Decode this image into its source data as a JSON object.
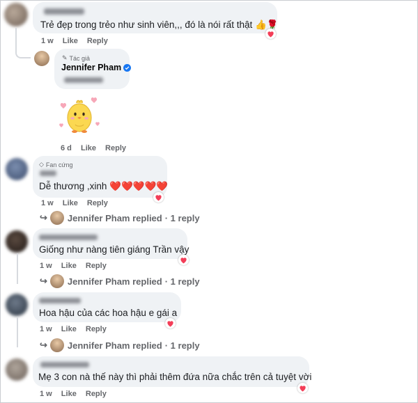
{
  "thread": [
    {
      "text": "Trẻ đẹp trong trẻo như sinh viên,,, đó là nói rất thật 👍🌹",
      "time": "1 w",
      "like": "Like",
      "reply": "Reply"
    }
  ],
  "author_reply": {
    "badge": "Tác giả",
    "name": "Jennifer Pham",
    "time": "6 d",
    "like": "Like",
    "reply": "Reply"
  },
  "comment2": {
    "badge": "Fan cứng",
    "text": "Dễ thương ,xinh ❤️❤️❤️❤️❤️",
    "time": "1 w",
    "like": "Like",
    "reply": "Reply",
    "replied": "Jennifer Pham replied",
    "replies": "· 1 reply"
  },
  "comment3": {
    "text": "Giống như nàng tiên giáng Trần vậy",
    "time": "1 w",
    "like": "Like",
    "reply": "Reply",
    "replied": "Jennifer Pham replied",
    "replies": "· 1 reply"
  },
  "comment4": {
    "text": "Hoa hậu của các hoa hậu e gái a",
    "time": "1 w",
    "like": "Like",
    "reply": "Reply",
    "replied": "Jennifer Pham replied",
    "replies": "· 1 reply"
  },
  "comment5": {
    "text": "Mẹ 3 con nà thế này thì phải thêm đứa nữa chắc trên cả tuyệt vời",
    "time": "1 w",
    "like": "Like",
    "reply": "Reply"
  },
  "colors": {
    "bubble": "#eff2f5",
    "meta": "#65676b",
    "verified": "#1877f2",
    "heart": "#f33e58"
  }
}
